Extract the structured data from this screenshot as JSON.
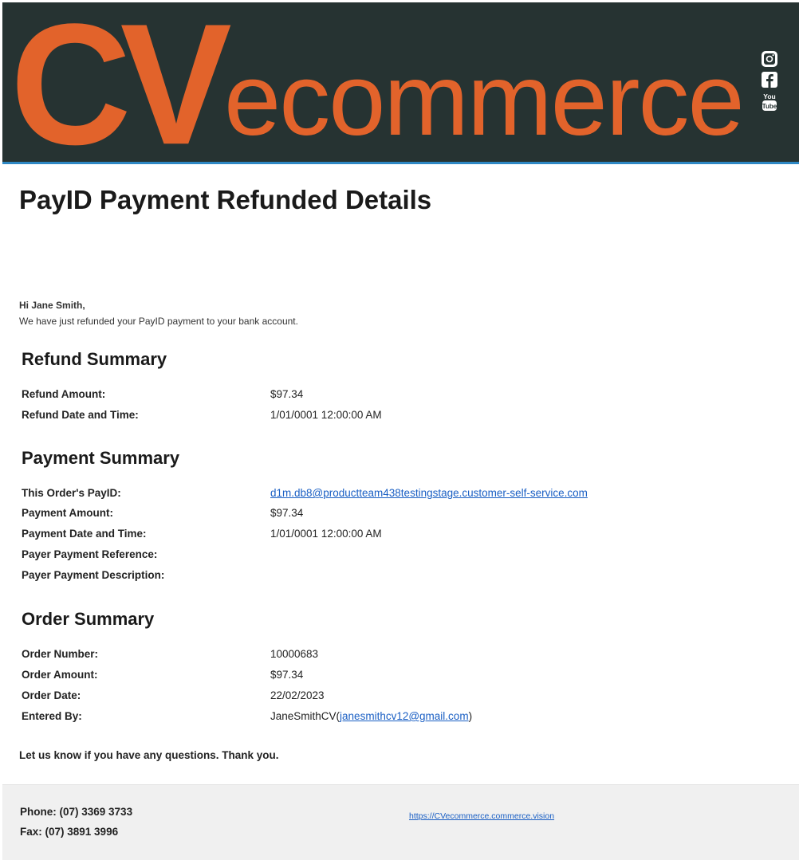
{
  "brand": {
    "logo_cv": "CV",
    "logo_word": "ecommerce",
    "colors": {
      "header_bg": "#263332",
      "accent": "#e2632b",
      "rule": "#2e88c4"
    },
    "social_icons": [
      "instagram-icon",
      "facebook-icon",
      "youtube-icon"
    ]
  },
  "title": "PayID Payment Refunded Details",
  "greeting": "Hi Jane Smith,",
  "intro": "We have just refunded your PayID payment to your bank account.",
  "refund_summary": {
    "heading": "Refund Summary",
    "rows": [
      {
        "label": "Refund Amount:",
        "value": "$97.34"
      },
      {
        "label": "Refund Date and Time:",
        "value": "1/01/0001 12:00:00 AM"
      }
    ]
  },
  "payment_summary": {
    "heading": "Payment Summary",
    "rows": [
      {
        "label": "This Order's PayID:",
        "value": "d1m.db8@productteam438testingstage.customer-self-service.com"
      },
      {
        "label": "Payment Amount:",
        "value": "$97.34"
      },
      {
        "label": "Payment Date and Time:",
        "value": "1/01/0001 12:00:00 AM"
      },
      {
        "label": "Payer Payment Reference:",
        "value": ""
      },
      {
        "label": "Payer Payment Description:",
        "value": ""
      }
    ]
  },
  "order_summary": {
    "heading": "Order Summary",
    "rows": [
      {
        "label": "Order Number:",
        "value": "10000683"
      },
      {
        "label": "Order Amount:",
        "value": "$97.34"
      },
      {
        "label": "Order Date:",
        "value": "22/02/2023"
      },
      {
        "label": "Entered By:",
        "value": "JaneSmithCV",
        "email": "janesmithcv12@gmail.com"
      }
    ]
  },
  "closing": "Let us know if you have any questions. Thank you.",
  "footer": {
    "phone": "Phone: (07) 3369 3733",
    "fax": "Fax: (07) 3891 3996",
    "website": "https://CVecommerce.commerce.vision"
  }
}
